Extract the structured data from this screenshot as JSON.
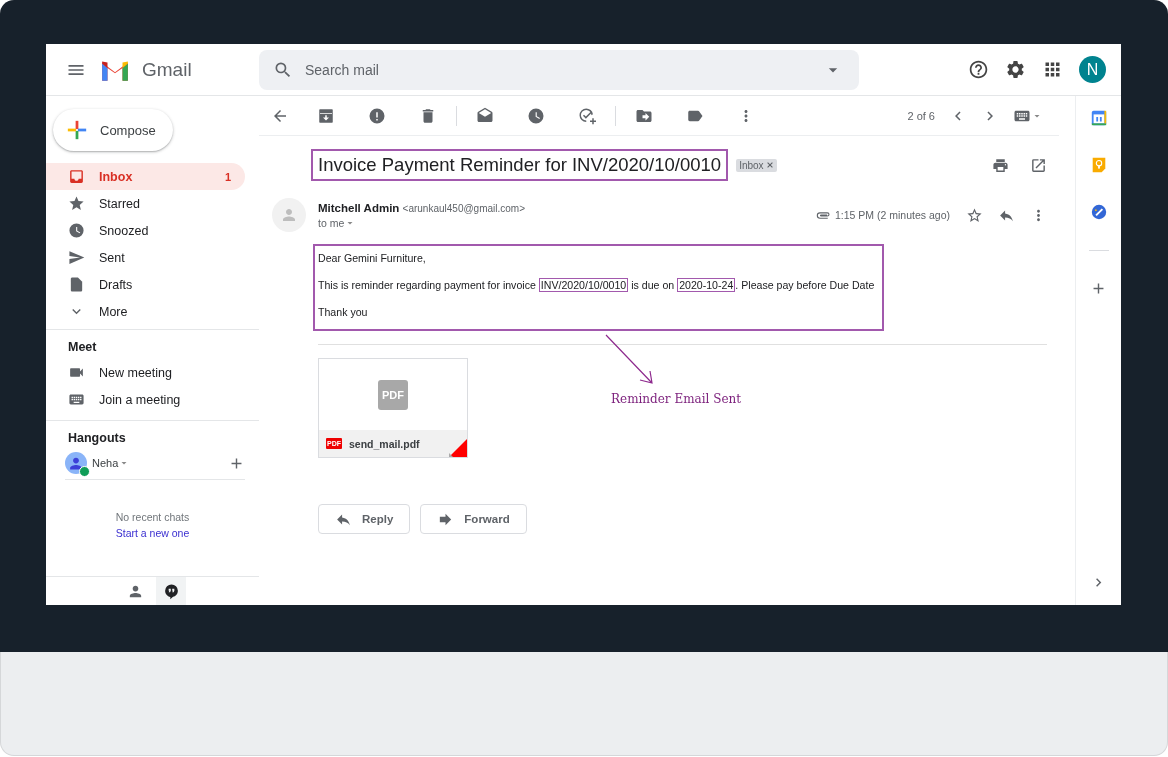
{
  "header": {
    "app_name": "Gmail",
    "search": {
      "placeholder": "Search mail"
    },
    "avatar_letter": "N"
  },
  "compose": "Compose",
  "nav": [
    {
      "label": "Inbox",
      "count": "1",
      "selected": true
    },
    {
      "label": "Starred",
      "selected": false
    },
    {
      "label": "Snoozed",
      "selected": false
    },
    {
      "label": "Sent",
      "selected": false
    },
    {
      "label": "Drafts",
      "selected": false
    },
    {
      "label": "More",
      "selected": false
    }
  ],
  "meet": {
    "title": "Meet",
    "items": [
      "New meeting",
      "Join a meeting"
    ]
  },
  "hangouts": {
    "title": "Hangouts",
    "user": "Neha",
    "online": true,
    "empty_text": "No recent chats",
    "link": "Start a new one"
  },
  "toolbar": {
    "pager": "2 of 6"
  },
  "message": {
    "subject": "Invoice Payment Reminder for INV/2020/10/0010",
    "subject_highlighted": true,
    "label": "Inbox",
    "sender_name": "Mitchell Admin",
    "sender_email": "<arunkaul450@gmail.com>",
    "recipient": "to me",
    "time": "1:15 PM (2 minutes ago)",
    "body_highlighted": true,
    "body": [
      [
        {
          "text": "Dear Gemini Furniture,",
          "boxed": false
        }
      ],
      [
        {
          "text": "This is reminder regarding payment for invoice ",
          "boxed": false
        },
        {
          "text": "INV/2020/10/0010",
          "boxed": true
        },
        {
          "text": " is due on ",
          "boxed": false
        },
        {
          "text": "2020-10-24",
          "boxed": true
        },
        {
          "text": ". Please pay before Due Date",
          "boxed": false
        }
      ],
      [
        {
          "text": "Thank you",
          "boxed": false
        }
      ]
    ]
  },
  "attachment": {
    "thumb_text": "PDF",
    "type_badge": "PDF",
    "filename": "send_mail.pdf"
  },
  "actions": [
    "Reply",
    "Forward"
  ],
  "annotation": "Reminder Email Sent"
}
